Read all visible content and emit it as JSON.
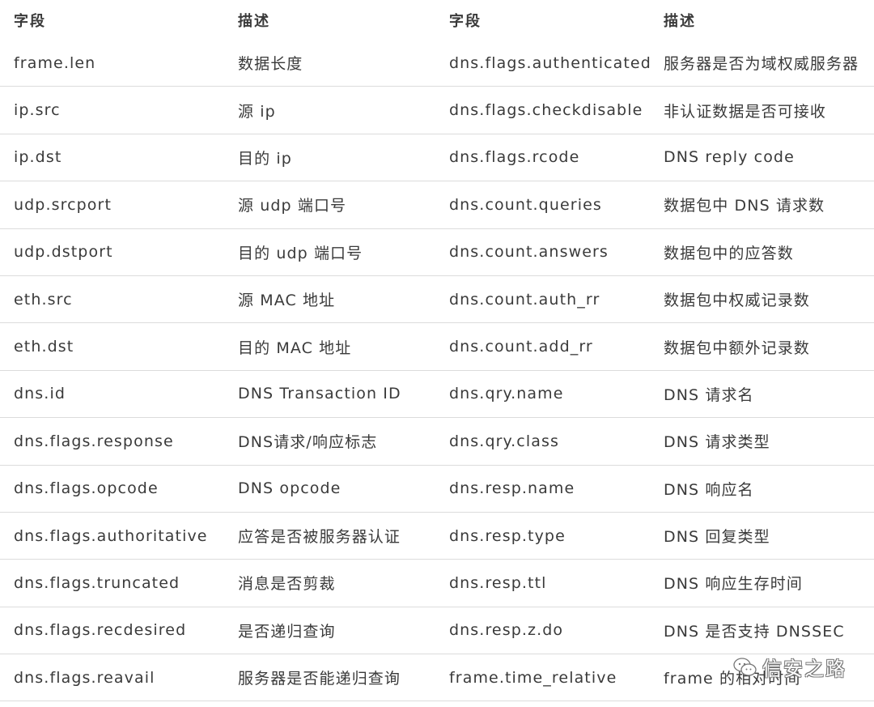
{
  "table": {
    "headers": [
      "字段",
      "描述",
      "字段",
      "描述"
    ],
    "rows": [
      [
        "frame.len",
        "数据长度",
        "dns.flags.authenticated",
        "服务器是否为域权威服务器"
      ],
      [
        "ip.src",
        "源 ip",
        "dns.flags.checkdisable",
        "非认证数据是否可接收"
      ],
      [
        "ip.dst",
        "目的 ip",
        "dns.flags.rcode",
        "DNS reply code"
      ],
      [
        "udp.srcport",
        "源 udp 端口号",
        "dns.count.queries",
        "数据包中 DNS 请求数"
      ],
      [
        "udp.dstport",
        "目的 udp 端口号",
        "dns.count.answers",
        "数据包中的应答数"
      ],
      [
        "eth.src",
        "源 MAC 地址",
        "dns.count.auth_rr",
        "数据包中权威记录数"
      ],
      [
        "eth.dst",
        "目的 MAC 地址",
        "dns.count.add_rr",
        "数据包中额外记录数"
      ],
      [
        "dns.id",
        "DNS Transaction ID",
        "dns.qry.name",
        "DNS 请求名"
      ],
      [
        "dns.flags.response",
        "DNS请求/响应标志",
        "dns.qry.class",
        "DNS 请求类型"
      ],
      [
        "dns.flags.opcode",
        "DNS opcode",
        "dns.resp.name",
        "DNS 响应名"
      ],
      [
        "dns.flags.authoritative",
        "应答是否被服务器认证",
        "dns.resp.type",
        "DNS 回复类型"
      ],
      [
        "dns.flags.truncated",
        "消息是否剪裁",
        "dns.resp.ttl",
        "DNS 响应生存时间"
      ],
      [
        "dns.flags.recdesired",
        "是否递归查询",
        "dns.resp.z.do",
        "DNS 是否支持 DNSSEC"
      ],
      [
        "dns.flags.reavail",
        "服务器是否能递归查询",
        "frame.time_relative",
        "frame 的相对时间"
      ]
    ]
  },
  "watermark": {
    "text": "信安之路",
    "icon": "wechat-icon"
  }
}
